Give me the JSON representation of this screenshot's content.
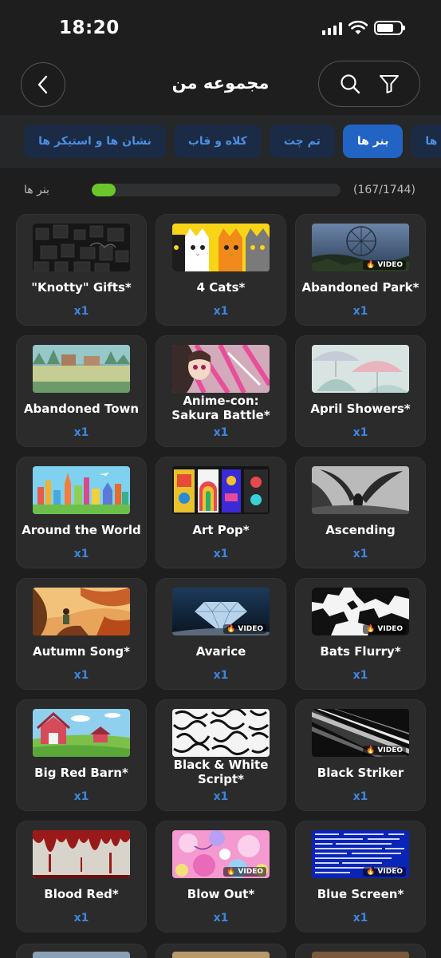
{
  "status": {
    "time": "18:20"
  },
  "header": {
    "title": "مجموعه من"
  },
  "tabs": [
    {
      "label": "تمام ایتم ها",
      "active": false
    },
    {
      "label": "بنر ها",
      "active": true
    },
    {
      "label": "تم چت",
      "active": false
    },
    {
      "label": "کلاه و قاب",
      "active": false
    },
    {
      "label": "نشان ها و استیکر ها",
      "active": false
    }
  ],
  "progress": {
    "count": "(167/1744)",
    "label": "بنر ها",
    "fraction": 0.096,
    "color": "#6cc62b"
  },
  "colors": {
    "accent": "#2264c4",
    "quantity": "#3d86e0"
  },
  "items": [
    {
      "name": "\"Knotty\" Gifts*",
      "qty": "x1",
      "video": false
    },
    {
      "name": "4 Cats*",
      "qty": "x1",
      "video": false
    },
    {
      "name": "Abandoned Park*",
      "qty": "x1",
      "video": true,
      "badge": "VIDEO"
    },
    {
      "name": "Abandoned Town",
      "qty": "x1",
      "video": false
    },
    {
      "name": "Anime-con: Sakura Battle*",
      "qty": "x1",
      "video": false
    },
    {
      "name": "April Showers*",
      "qty": "x1",
      "video": false
    },
    {
      "name": "Around the World",
      "qty": "x1",
      "video": false
    },
    {
      "name": "Art Pop*",
      "qty": "x1",
      "video": false
    },
    {
      "name": "Ascending",
      "qty": "x1",
      "video": false
    },
    {
      "name": "Autumn Song*",
      "qty": "x1",
      "video": false
    },
    {
      "name": "Avarice",
      "qty": "x1",
      "video": true,
      "badge": "VIDEO"
    },
    {
      "name": "Bats Flurry*",
      "qty": "x1",
      "video": true,
      "badge": "VIDEO"
    },
    {
      "name": "Big Red Barn*",
      "qty": "x1",
      "video": false
    },
    {
      "name": "Black & White Script*",
      "qty": "x1",
      "video": false
    },
    {
      "name": "Black Striker",
      "qty": "x1",
      "video": true,
      "badge": "VIDEO"
    },
    {
      "name": "Blood Red*",
      "qty": "x1",
      "video": false
    },
    {
      "name": "Blow Out*",
      "qty": "x1",
      "video": true,
      "badge": "VIDEO"
    },
    {
      "name": "Blue Screen*",
      "qty": "x1",
      "video": true,
      "badge": "VIDEO"
    }
  ]
}
